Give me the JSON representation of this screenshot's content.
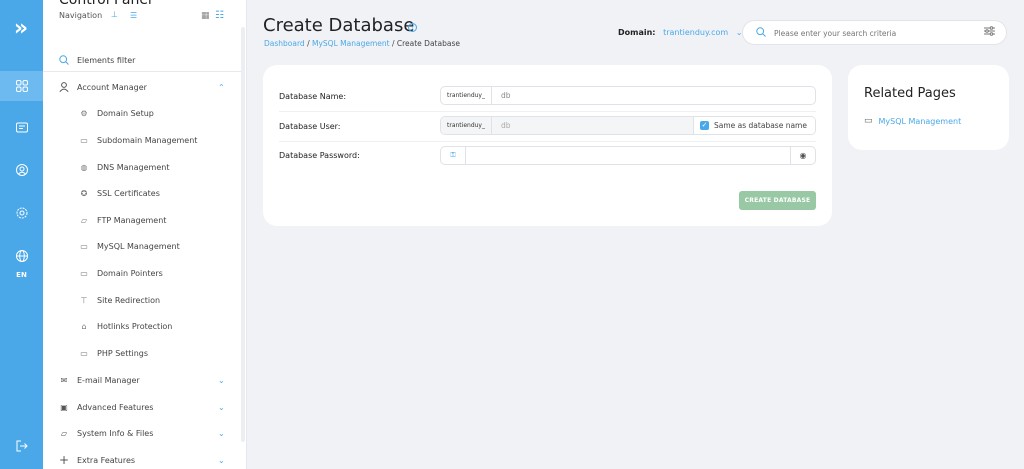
{
  "sidebar": {
    "title": "Control Panel",
    "nav_label": "Navigation",
    "filter_label": "Elements filter",
    "account_manager": "Account Manager",
    "sub_items": [
      "Domain Setup",
      "Subdomain Management",
      "DNS Management",
      "SSL Certificates",
      "FTP Management",
      "MySQL Management",
      "Domain Pointers",
      "Site Redirection",
      "Hotlinks Protection",
      "PHP Settings"
    ],
    "groups": [
      "E-mail Manager",
      "Advanced Features",
      "System Info & Files",
      "Extra Features"
    ]
  },
  "rail": {
    "lang": "EN"
  },
  "header": {
    "title": "Create Database",
    "breadcrumb": {
      "home": "Dashboard",
      "parent": "MySQL Management",
      "current": "Create Database"
    },
    "domain_label": "Domain:",
    "domain_value": "trantienduy.com",
    "search_placeholder": "Please enter your search criteria"
  },
  "form": {
    "db_name_label": "Database Name:",
    "db_user_label": "Database User:",
    "db_pass_label": "Database Password:",
    "prefix": "trantienduy_",
    "db_name_value": "db",
    "db_user_value": "db",
    "same_as_label": "Same as database name",
    "submit_label": "CREATE DATABASE"
  },
  "related": {
    "title": "Related Pages",
    "links": [
      "MySQL Management"
    ]
  },
  "colors": {
    "accent": "#4aa8e8",
    "button": "#98c8a4"
  }
}
